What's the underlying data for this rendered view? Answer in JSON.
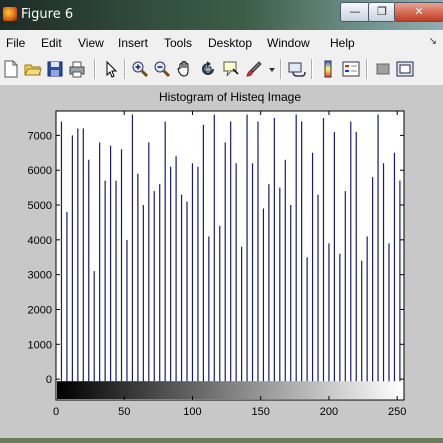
{
  "window": {
    "title": "Figure 6",
    "min_glyph": "—",
    "max_glyph": "❐",
    "close_glyph": "✕"
  },
  "menubar": {
    "items": [
      "File",
      "Edit",
      "View",
      "Insert",
      "Tools",
      "Desktop",
      "Window",
      "Help"
    ],
    "pin": "↘"
  },
  "toolbar": {
    "icons": [
      "new-figure-icon",
      "open-file-icon",
      "save-icon",
      "print-icon",
      "select-arrow-icon",
      "zoom-in-icon",
      "zoom-out-icon",
      "pan-icon",
      "rotate-icon",
      "data-cursor-icon",
      "brush-icon",
      "link-icon",
      "colorbar-icon",
      "legend-icon",
      "hide-plot-tools-icon",
      "show-plot-tools-icon"
    ]
  },
  "chart_data": {
    "type": "bar",
    "title": "Histogram of Histeq Image",
    "xlim": [
      0,
      255
    ],
    "ylim": [
      -600,
      7700
    ],
    "xticks": [
      0,
      50,
      100,
      150,
      200,
      250
    ],
    "yticks": [
      0,
      1000,
      2000,
      3000,
      4000,
      5000,
      6000,
      7000
    ],
    "colorbar": "grayscale 0-255",
    "bar_color": "#1a1a6e",
    "x": [
      4,
      8,
      12,
      16,
      20,
      24,
      28,
      32,
      36,
      40,
      44,
      48,
      52,
      56,
      60,
      64,
      68,
      72,
      76,
      80,
      84,
      88,
      92,
      96,
      100,
      104,
      108,
      112,
      116,
      120,
      124,
      128,
      132,
      136,
      140,
      144,
      148,
      152,
      156,
      160,
      164,
      168,
      172,
      176,
      180,
      184,
      188,
      192,
      196,
      200,
      204,
      208,
      212,
      216,
      220,
      224,
      228,
      232,
      236,
      240,
      244,
      248,
      252
    ],
    "values": [
      7400,
      4800,
      7000,
      7200,
      7200,
      6300,
      3100,
      6800,
      5700,
      6700,
      5700,
      6600,
      4000,
      7600,
      5900,
      5000,
      6800,
      5400,
      5600,
      7400,
      6100,
      6400,
      5300,
      5100,
      6200,
      6100,
      7300,
      4100,
      7600,
      4400,
      6800,
      7400,
      6200,
      3800,
      7600,
      6200,
      7400,
      4900,
      5600,
      7500,
      5500,
      6300,
      5000,
      7600,
      7400,
      3500,
      6500,
      5300,
      7500,
      3900,
      7100,
      3600,
      5400,
      7400,
      7100,
      3400,
      4100,
      5800,
      7600,
      6200,
      3900,
      6500,
      5700
    ]
  }
}
